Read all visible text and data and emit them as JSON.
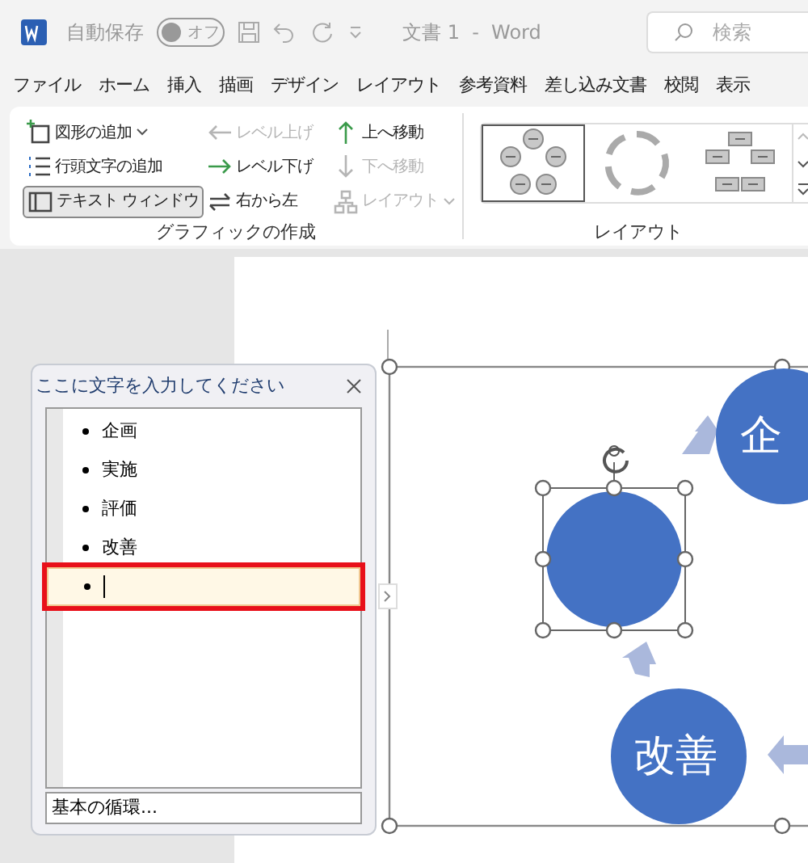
{
  "title_bar": {
    "autosave_label": "自動保存",
    "autosave_toggle": {
      "label": "オフ",
      "on": false
    },
    "document_title": "文書 1  -  Word",
    "search": {
      "placeholder": "検索"
    }
  },
  "menu_tabs": [
    "ファイル",
    "ホーム",
    "挿入",
    "描画",
    "デザイン",
    "レイアウト",
    "参考資料",
    "差し込み文書",
    "校閲",
    "表示"
  ],
  "ribbon": {
    "create_group": {
      "title": "グラフィックの作成",
      "buttons": [
        {
          "label": "図形の追加",
          "kind": "add-shape",
          "disabled": false,
          "dropdown": true,
          "pressed": false
        },
        {
          "label": "行頭文字の追加",
          "kind": "bullets",
          "disabled": false,
          "dropdown": false,
          "pressed": false
        },
        {
          "label": "テキスト ウィンドウ",
          "kind": "text-pane",
          "disabled": false,
          "dropdown": false,
          "pressed": true
        },
        {
          "label": "レベル上げ",
          "kind": "left",
          "disabled": true,
          "dropdown": false,
          "pressed": false
        },
        {
          "label": "レベル下げ",
          "kind": "right",
          "disabled": false,
          "dropdown": false,
          "pressed": false
        },
        {
          "label": "右から左",
          "kind": "swap",
          "disabled": false,
          "dropdown": false,
          "pressed": false
        },
        {
          "label": "上へ移動",
          "kind": "up",
          "disabled": false,
          "dropdown": false,
          "pressed": false
        },
        {
          "label": "下へ移動",
          "kind": "down",
          "disabled": true,
          "dropdown": false,
          "pressed": false
        },
        {
          "label": "レイアウト",
          "kind": "org",
          "disabled": true,
          "dropdown": true,
          "pressed": false
        }
      ]
    },
    "layout_group": {
      "title": "レイアウト",
      "layouts": [
        {
          "kind": "circles",
          "selected": true
        },
        {
          "kind": "arrows",
          "selected": false
        },
        {
          "kind": "boxes",
          "selected": false
        }
      ]
    }
  },
  "text_pane": {
    "title": "ここに文字を入力してください",
    "items": [
      {
        "text": "企画",
        "editing": false
      },
      {
        "text": "実施",
        "editing": false
      },
      {
        "text": "評価",
        "editing": false
      },
      {
        "text": "改善",
        "editing": false
      },
      {
        "editing": true
      }
    ],
    "footer": "基本の循環..."
  },
  "diagram": {
    "nodes": [
      {
        "text": "企",
        "selected": false
      },
      {
        "selected": true
      },
      {
        "text": "改善",
        "selected": false
      }
    ]
  }
}
